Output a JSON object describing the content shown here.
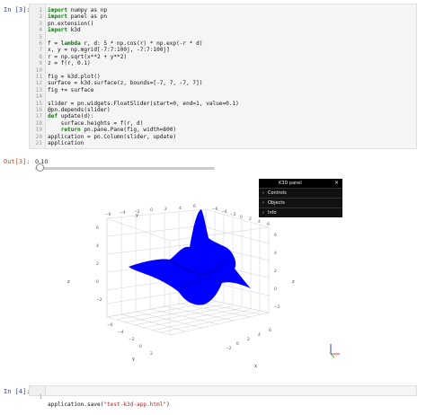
{
  "cell1": {
    "prompt": "In [3]:",
    "lines": [
      {
        "n": "1",
        "pre": "",
        "kw": "import",
        "post": " numpy as np"
      },
      {
        "n": "2",
        "pre": "",
        "kw": "import",
        "post": " panel as pn"
      },
      {
        "n": "3",
        "pre": "pn.extension()",
        "kw": "",
        "post": ""
      },
      {
        "n": "4",
        "pre": "",
        "kw": "import",
        "post": " k3d"
      },
      {
        "n": "5",
        "pre": "",
        "kw": "",
        "post": ""
      },
      {
        "n": "6",
        "pre": "f = ",
        "kw": "lambda",
        "post": " r, d: 5 * np.cos(r) * np.exp(-r * d)"
      },
      {
        "n": "7",
        "pre": "x, y = np.mgrid[-7:7:100j, -7:7:100j]",
        "kw": "",
        "post": ""
      },
      {
        "n": "8",
        "pre": "r = np.sqrt(x**2 + y**2)",
        "kw": "",
        "post": ""
      },
      {
        "n": "9",
        "pre": "z = f(r, 0.1)",
        "kw": "",
        "post": ""
      },
      {
        "n": "10",
        "pre": "",
        "kw": "",
        "post": ""
      },
      {
        "n": "11",
        "pre": "fig = k3d.plot()",
        "kw": "",
        "post": ""
      },
      {
        "n": "12",
        "pre": "surface = k3d.surface(z, bounds=[-7, 7, -7, 7])",
        "kw": "",
        "post": ""
      },
      {
        "n": "13",
        "pre": "fig += surface",
        "kw": "",
        "post": ""
      },
      {
        "n": "14",
        "pre": "",
        "kw": "",
        "post": ""
      },
      {
        "n": "15",
        "pre": "slider = pn.widgets.FloatSlider(start=0, end=1, value=0.1)",
        "kw": "",
        "post": ""
      },
      {
        "n": "16",
        "pre": "@pn.depends(slider)",
        "kw": "",
        "post": ""
      },
      {
        "n": "17",
        "pre": "",
        "kw": "def",
        "post": " update(d):"
      },
      {
        "n": "18",
        "pre": "    surface.heights = f(r, d)",
        "kw": "",
        "post": ""
      },
      {
        "n": "19",
        "pre": "    ",
        "kw": "return",
        "post": " pn.pane.Pane(fig, width=800)"
      },
      {
        "n": "20",
        "pre": "application = pn.Column(slider, update)",
        "kw": "",
        "post": ""
      },
      {
        "n": "21",
        "pre": "application",
        "kw": "",
        "post": ""
      }
    ]
  },
  "output": {
    "prompt": "Out[3]:",
    "slider_value": "0.10",
    "slider_fraction": 0.1
  },
  "k3d_panel": {
    "title": "K3D panel",
    "close": "×",
    "folders": [
      "Controls",
      "Objects",
      "Info"
    ]
  },
  "plot": {
    "z_label": "z",
    "y_label": "y",
    "x_label": "x",
    "surface_color": "#0000ff",
    "ticks": [
      "−6",
      "−4",
      "−2",
      "0",
      "2",
      "4",
      "6"
    ]
  },
  "cell2": {
    "prompt": "In [4]:",
    "line_number": "1",
    "code_pre": "application.save(",
    "code_string": "\"test-k3d-app.html\"",
    "code_post": ")"
  }
}
